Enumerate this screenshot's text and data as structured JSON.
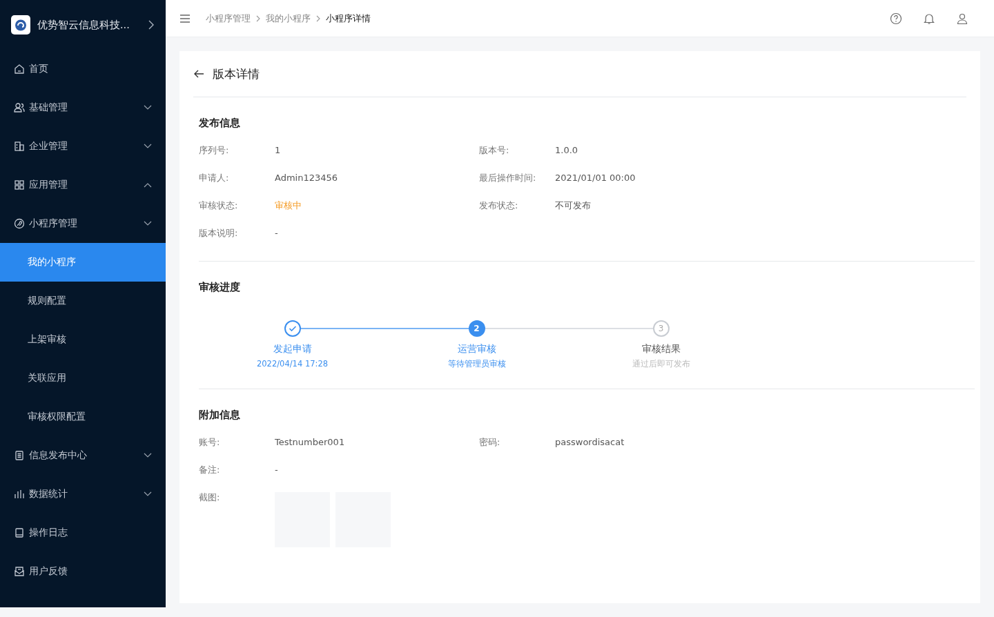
{
  "sidebar": {
    "company": "优势智云信息科技...",
    "items": [
      {
        "label": "首页",
        "kind": "item",
        "selected": false
      },
      {
        "label": "基础管理",
        "kind": "group",
        "expanded": false,
        "selected": false
      },
      {
        "label": "企业管理",
        "kind": "group",
        "expanded": false,
        "selected": false
      },
      {
        "label": "应用管理",
        "kind": "group",
        "expanded": true,
        "selected": false
      },
      {
        "label": "小程序管理",
        "kind": "group",
        "expanded": false,
        "selected": false
      },
      {
        "label": "我的小程序",
        "kind": "sub",
        "selected": true
      },
      {
        "label": "规则配置",
        "kind": "sub",
        "selected": false
      },
      {
        "label": "上架审核",
        "kind": "sub",
        "selected": false
      },
      {
        "label": "关联应用",
        "kind": "sub",
        "selected": false
      },
      {
        "label": "审核权限配置",
        "kind": "sub",
        "selected": false
      },
      {
        "label": "信息发布中心",
        "kind": "group",
        "expanded": false,
        "selected": false
      },
      {
        "label": "数据统计",
        "kind": "group",
        "expanded": false,
        "selected": false
      },
      {
        "label": "操作日志",
        "kind": "item",
        "selected": false
      },
      {
        "label": "用户反馈",
        "kind": "item",
        "selected": false
      }
    ]
  },
  "breadcrumb": [
    "小程序管理",
    "我的小程序",
    "小程序详情"
  ],
  "page_title": "版本详情",
  "publish_info": {
    "title": "发布信息",
    "rows": [
      [
        {
          "label": "序列号:",
          "value": "1",
          "kind": "text"
        },
        {
          "label": "版本号:",
          "value": "1.0.0",
          "kind": "text"
        }
      ],
      [
        {
          "label": "申请人:",
          "value": "Admin123456",
          "kind": "text"
        },
        {
          "label": "最后操作时间:",
          "value": "2021/01/01 00:00",
          "kind": "text"
        }
      ],
      [
        {
          "label": "审核状态:",
          "value": "审核中",
          "kind": "warning"
        },
        {
          "label": "发布状态:",
          "value": "不可发布",
          "kind": "text"
        }
      ],
      [
        {
          "label": "版本说明:",
          "value": "-",
          "kind": "text"
        }
      ]
    ]
  },
  "review_progress": {
    "title": "审核进度",
    "steps": [
      {
        "done": true,
        "selected": false,
        "title": "发起申请",
        "description": "2022/04/14 17:28"
      },
      {
        "done": false,
        "selected": true,
        "number": "2",
        "title": "运营审核",
        "description": "等待管理员审核"
      },
      {
        "done": false,
        "selected": false,
        "number": "3",
        "title": "审核结果",
        "description": "通过后即可发布"
      }
    ]
  },
  "extra_info": {
    "title": "附加信息",
    "rows": [
      [
        {
          "label": "账号:",
          "value": "Testnumber001",
          "kind": "text"
        },
        {
          "label": "密码:",
          "value": "passwordisacat",
          "kind": "text"
        }
      ],
      [
        {
          "label": "备注:",
          "value": "-",
          "kind": "text"
        }
      ],
      [
        {
          "label": "截图:",
          "kind": "images",
          "images": [
            {
              "kind": "image"
            },
            {
              "kind": "image"
            }
          ]
        }
      ]
    ]
  }
}
